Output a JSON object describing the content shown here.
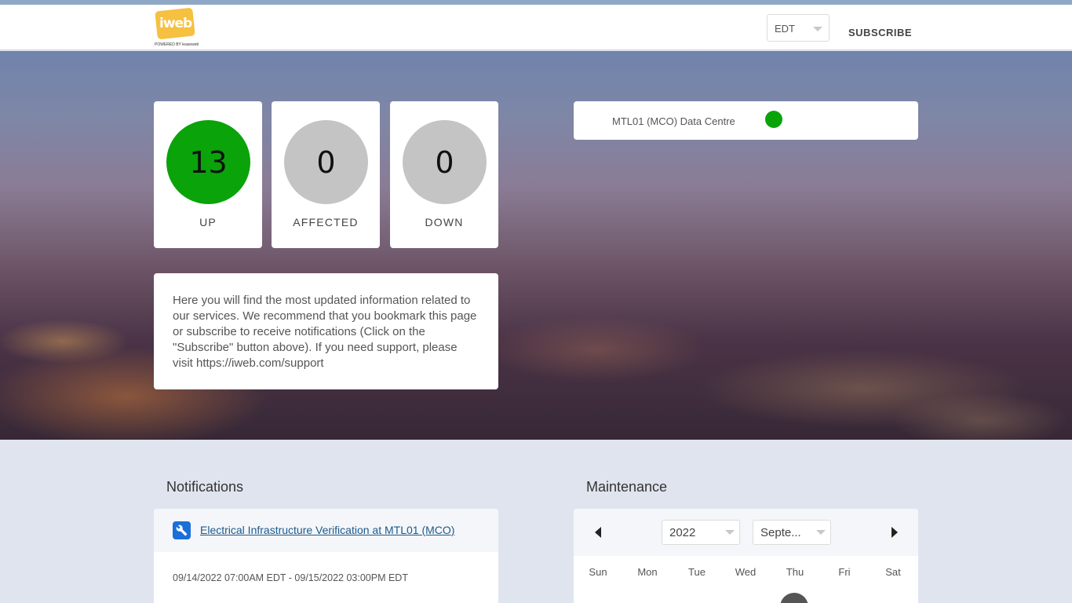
{
  "header": {
    "logo_text": "iweb",
    "logo_sub": "POWERED BY leaseweb",
    "timezone": "EDT",
    "subscribe_label": "SUBSCRIBE"
  },
  "stats": [
    {
      "value": "13",
      "label": "UP",
      "color": "#0aa30a"
    },
    {
      "value": "0",
      "label": "AFFECTED",
      "color": "#c4c4c4"
    },
    {
      "value": "0",
      "label": "DOWN",
      "color": "#c4c4c4"
    }
  ],
  "info": {
    "text": "Here you will find the most updated information related to our services. We recommend that you bookmark this page or subscribe to receive notifications (Click on the \"Subscribe\" button above). If you need support, please visit https://iweb.com/support"
  },
  "datacentre": {
    "name": "MTL01 (MCO) Data Centre",
    "status_color": "#0aa30a"
  },
  "notifications": {
    "title": "Notifications",
    "items": [
      {
        "icon": "wrench-icon",
        "title": "Electrical Infrastructure Verification at MTL01 (MCO)",
        "date_range": "09/14/2022 07:00AM EDT - 09/15/2022 03:00PM EDT"
      }
    ]
  },
  "maintenance": {
    "title": "Maintenance",
    "year": "2022",
    "month": "Septe...",
    "weekdays": [
      "Sun",
      "Mon",
      "Tue",
      "Wed",
      "Thu",
      "Fri",
      "Sat"
    ]
  },
  "colors": {
    "up": "#0aa30a",
    "neutral": "#c4c4c4",
    "link": "#1d5a8a",
    "accent": "#1a6fd8"
  }
}
